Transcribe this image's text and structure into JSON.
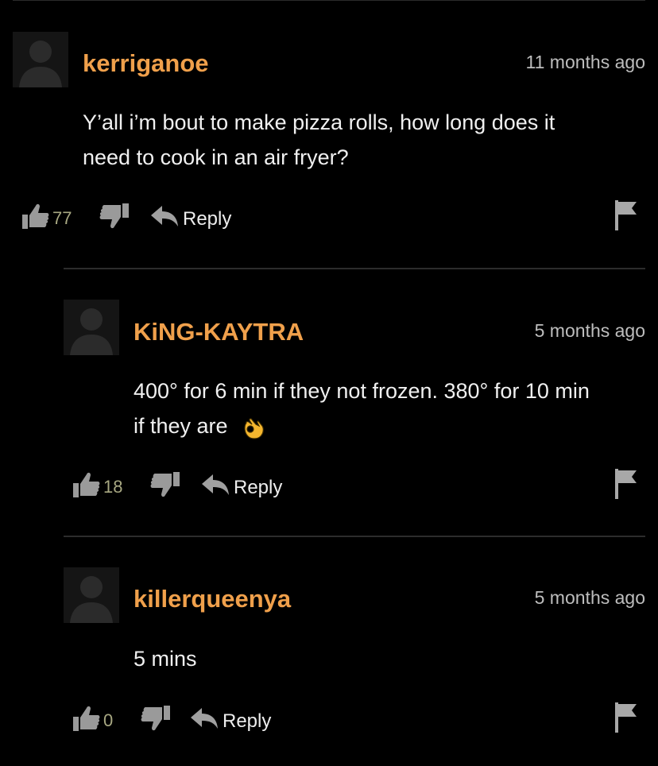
{
  "comments": [
    {
      "username": "kerriganoe",
      "timestamp": "11 months ago",
      "text_lines": [
        "Y’all i’m bout to make pizza rolls, how long does it",
        "need to cook in an air fryer?"
      ],
      "likes": "77",
      "reply_label": "Reply"
    },
    {
      "username": "KiNG-KAYTRA",
      "timestamp": "5 months ago",
      "text_lines": [
        "400° for 6 min if they not frozen. 380° for 10 min",
        "if they are"
      ],
      "emoji": "ok-hand-emoji",
      "likes": "18",
      "reply_label": "Reply"
    },
    {
      "username": "killerqueenya",
      "timestamp": "5 months ago",
      "text_lines": [
        "5 mins"
      ],
      "likes": "0",
      "reply_label": "Reply"
    }
  ],
  "icons": {
    "like": "thumbs-up-icon",
    "dislike": "thumbs-down-icon",
    "reply": "reply-arrow-icon",
    "flag": "flag-icon",
    "avatar": "default-avatar-icon"
  },
  "colors": {
    "background": "#000000",
    "username": "#f0a04b",
    "text": "#f0f0f0",
    "timestamp": "#bdbdbd",
    "like_count": "#a8a882",
    "icon": "#9a9a9a",
    "divider": "#2c2c2c"
  }
}
